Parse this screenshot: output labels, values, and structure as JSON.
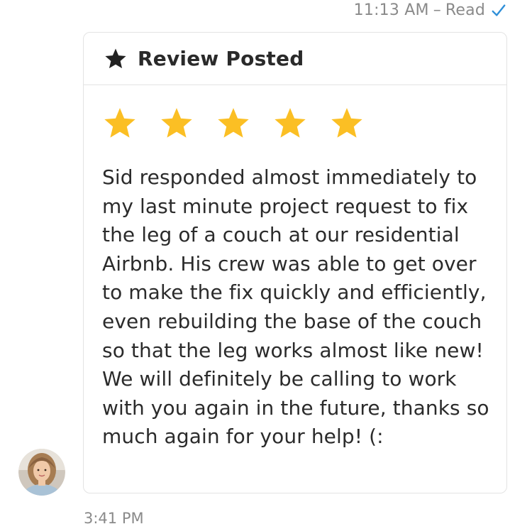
{
  "message_status": {
    "time": "11:13 AM",
    "separator": "–",
    "status": "Read",
    "check_icon": "check-icon",
    "check_color": "#2f8fd8"
  },
  "review_card": {
    "header_icon": "star-icon",
    "title": "Review Posted",
    "rating": 5,
    "rating_max": 5,
    "star_color": "#fbbf24",
    "text": "Sid responded almost immediately to my last minute project request to fix the leg of a couch at our residential Airbnb. His crew was able to get over to make the fix quickly and efficiently, even rebuilding the base of the couch so that the leg works almost like new! We will definitely be calling to work with you again in the future, thanks so much again for your help! (:"
  },
  "sender": {
    "avatar": "avatar-photo"
  },
  "next_message": {
    "time": "3:41 PM"
  }
}
